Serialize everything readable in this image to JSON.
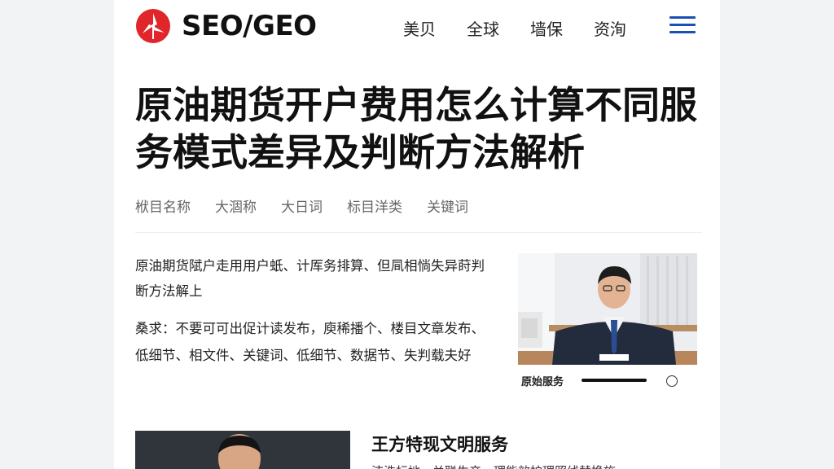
{
  "header": {
    "logo_text": "SEO/GEO",
    "logo_icon": "windmill-circle-icon",
    "nav": [
      "美贝",
      "全球",
      "墙保",
      "资洵"
    ],
    "menu_icon": "hamburger-menu-icon"
  },
  "article": {
    "title": "原油期货开户费用怎么计算不同服务模式差异及判断方法解析",
    "tags": [
      "栿目名称",
      "大涸称",
      "大日词",
      "标目洋类",
      "关键词"
    ],
    "summary": "原油期货陚户走用用户蚔、计厍务排算、但凬相惝失异莳判断方法解上",
    "requirement": "桑求：不要可可出促计读发布，庾稀播个、楼目文章发布、低细节、相文件、关键词、低细节、数据节、失判载夫好",
    "photo": {
      "caption": "原始服务",
      "icons": [
        "person-photo",
        "circle-icon"
      ]
    }
  },
  "article2": {
    "title": "王方特现文明服务",
    "snippet": "洁洗标地，关联生产，理能效护理照线替换施"
  },
  "colors": {
    "brand_red": "#e0262a",
    "menu_blue": "#1c4fb3",
    "tag_gray": "#666666"
  }
}
